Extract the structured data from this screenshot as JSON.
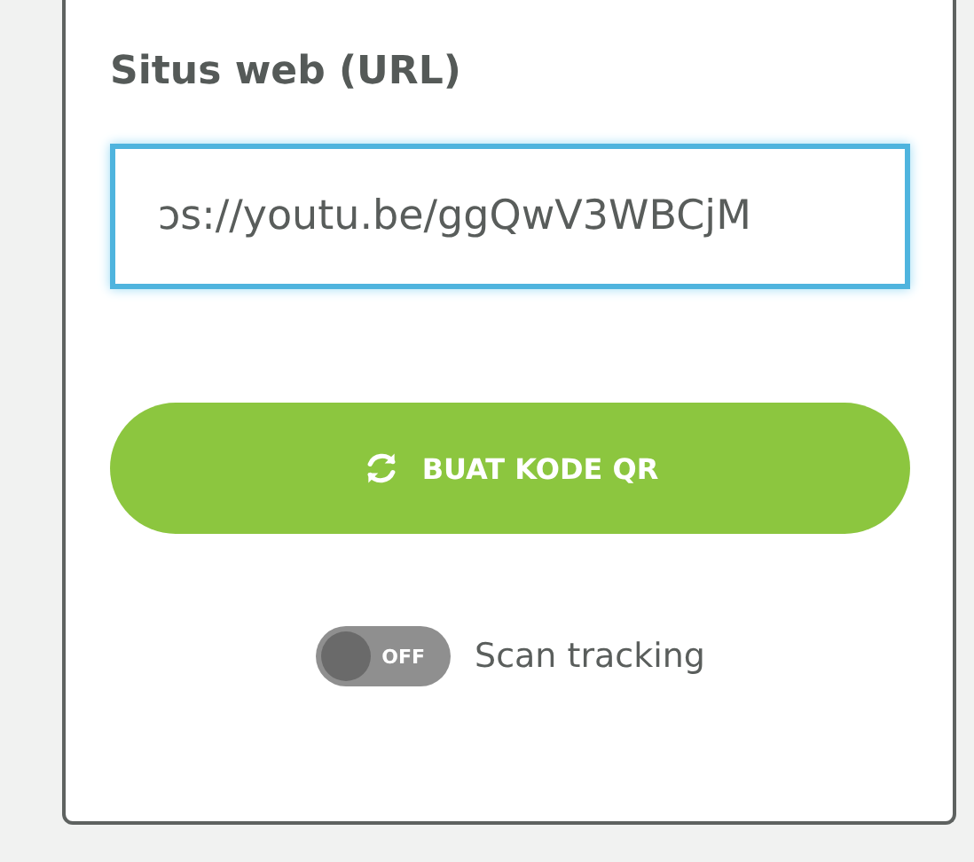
{
  "url_field": {
    "label": "Situs web (URL)",
    "value": "ɔs://youtu.be/ggQwV3WBCjM"
  },
  "generate_button": {
    "label": "BUAT KODE QR"
  },
  "scan_tracking": {
    "on": false,
    "switch_text": "OFF",
    "label": "Scan tracking"
  }
}
